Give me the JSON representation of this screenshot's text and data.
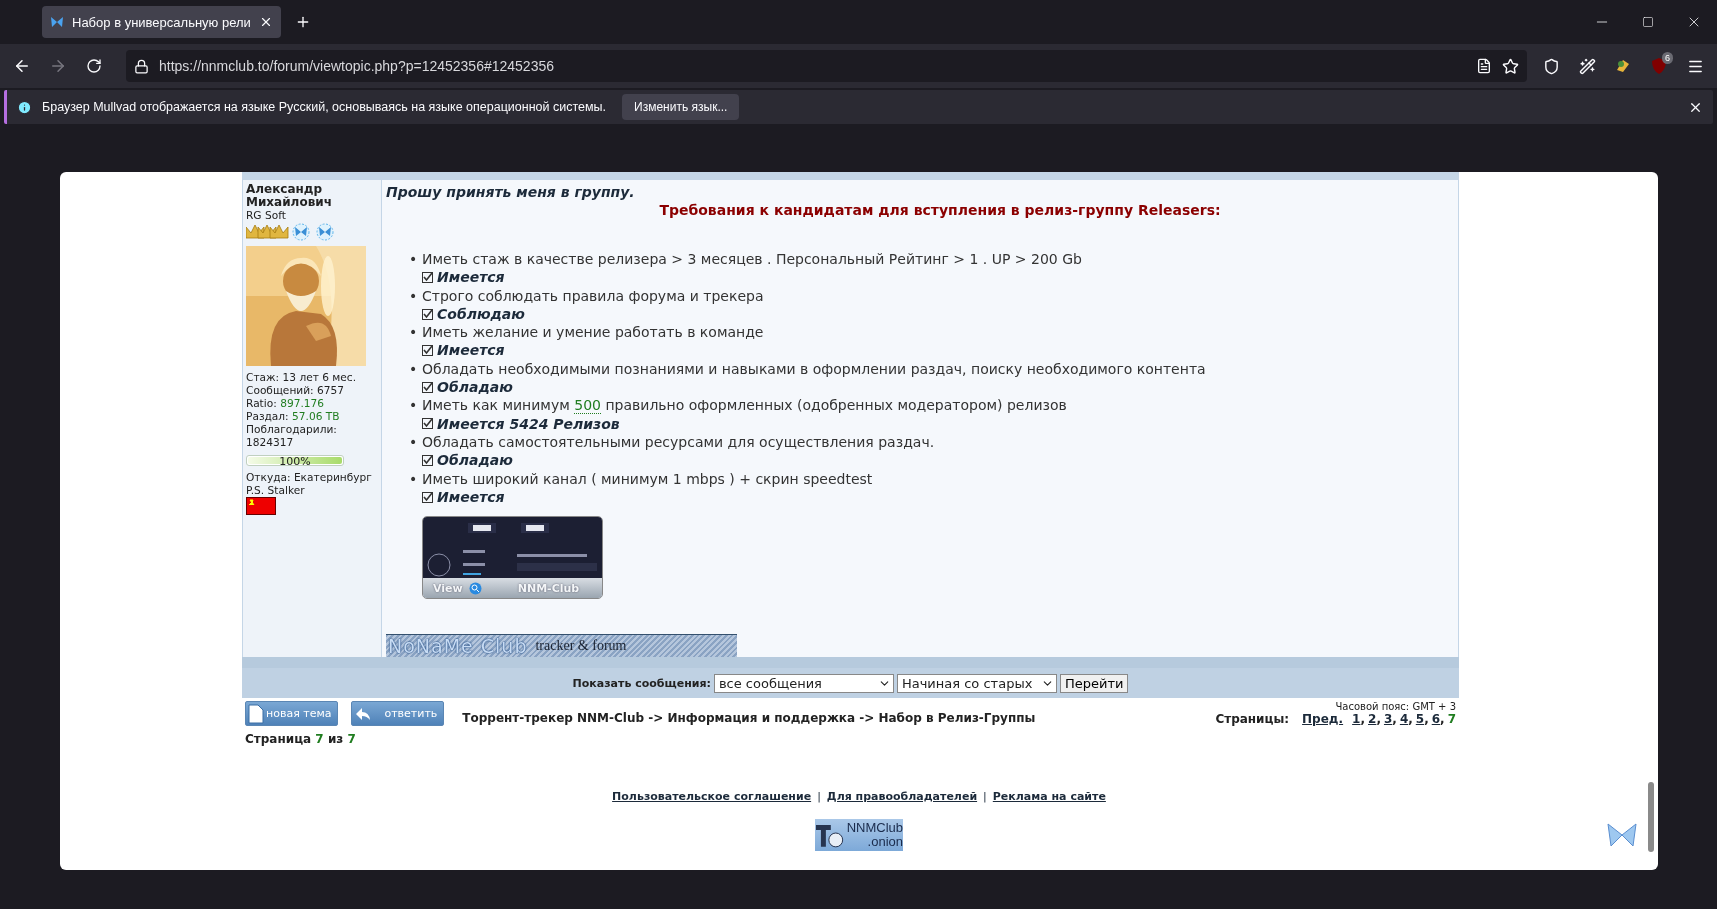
{
  "browser": {
    "tab": {
      "title": "Набор в универсальную рели",
      "selected": true
    },
    "url": "https://nnmclub.to/forum/viewtopic.php?p=12452356#12452356",
    "extension_badge": "6",
    "notification": {
      "message": "Браузер Mullvad отображается на языке Русский, основываясь на языке операционной системы.",
      "button": "Изменить язык..."
    }
  },
  "post": {
    "author": {
      "name": "Александр Михайлович",
      "group": "RG Soft",
      "stats": [
        {
          "label": "Стаж:",
          "value": "13 лет 6 мес.",
          "highlight": false
        },
        {
          "label": "Сообщений:",
          "value": "6757",
          "highlight": false
        },
        {
          "label": "Ratio:",
          "value": "897.176",
          "highlight": true
        },
        {
          "label": "Раздал:",
          "value": "57.06 TB",
          "highlight": true
        },
        {
          "label": "Поблагодарили:",
          "value": "1824317",
          "highlight": false
        }
      ],
      "progress": {
        "level": 1,
        "label": "100%"
      },
      "location": "Откуда: Екатеринбург",
      "signature": "P.S. Stalker"
    },
    "greeting": "Прошу принять меня в группу.",
    "heading": "Требования к кандидатам для вступления в релиз-группу Releasers:",
    "requirements": [
      {
        "marker": "•",
        "text": "Иметь стаж в качестве релизера > 3 месяцев . Персональный Рейтинг > 1 . UP > 200 Gb",
        "answer": "Имеется",
        "checked": true
      },
      {
        "marker": "•",
        "text": "Строго соблюдать правила форума и трекера",
        "answer": "Соблюдаю",
        "checked": true
      },
      {
        "marker": "•",
        "text": "Иметь желание и умение работать в команде",
        "answer": "Имеется",
        "checked": true
      },
      {
        "marker": "•",
        "text": "Обладать необходимыми познаниями и навыками в оформлении раздач, поиску необходимого контента",
        "answer": "Обладаю",
        "checked": true
      },
      {
        "marker": "•",
        "text": "Иметь как минимум",
        "number": "500",
        "text_after": "правильно оформленных (одобренных модератором) релизов",
        "answer": "Имеется 5424 Релизов",
        "checked": true
      },
      {
        "marker": "•",
        "text": "Обладать самостоятельными ресурсами для осуществления раздач.",
        "answer": "Обладаю",
        "checked": true
      },
      {
        "marker": "•",
        "text": "Иметь широкий канал ( минимум 1 mbps ) + скрин speedtest",
        "answer": "Имеется",
        "checked": true
      }
    ],
    "speedtest": {
      "view": "View",
      "brand": "NNM-Club"
    },
    "banner": {
      "logo": "NoNaMe Club",
      "tagline": "tracker & forum"
    }
  },
  "controls": {
    "label": "Показать сообщения:",
    "filter": "все сообщения",
    "order": "Начиная со старых",
    "submit": "Перейти"
  },
  "actions": [
    {
      "kind": "new",
      "label": "новая тема"
    },
    {
      "kind": "reply",
      "label": "ответить"
    }
  ],
  "breadcrumb": "Торрент-трекер NNM-Club -> Информация и поддержка -> Набор в Релиз-Группы",
  "timezone": "Часовой пояс: GMT + 3",
  "pagination": {
    "label": "Страницы:",
    "prev": "Пред.",
    "pages": [
      {
        "label": "1",
        "separator": ",",
        "selected": false
      },
      {
        "label": "2",
        "separator": ",",
        "selected": false
      },
      {
        "label": "3",
        "separator": ",",
        "selected": false
      },
      {
        "label": "4",
        "separator": ",",
        "selected": false
      },
      {
        "label": "5",
        "separator": ",",
        "selected": false
      },
      {
        "label": "6",
        "separator": ",",
        "selected": false
      },
      {
        "label": "7",
        "selected": true
      }
    ]
  },
  "page_info": {
    "label": "Страница",
    "current": "7",
    "separator": "из",
    "total": "7"
  },
  "footer": [
    {
      "kind": "link",
      "text": "Пользовательское соглашение"
    },
    {
      "kind": "separator",
      "text": "|"
    },
    {
      "kind": "link",
      "text": "Для правообладателей"
    },
    {
      "kind": "separator",
      "text": "|"
    },
    {
      "kind": "link",
      "text": "Реклама на сайте"
    }
  ],
  "onion": {
    "line1": "NNMClub",
    "line2": ".onion"
  }
}
